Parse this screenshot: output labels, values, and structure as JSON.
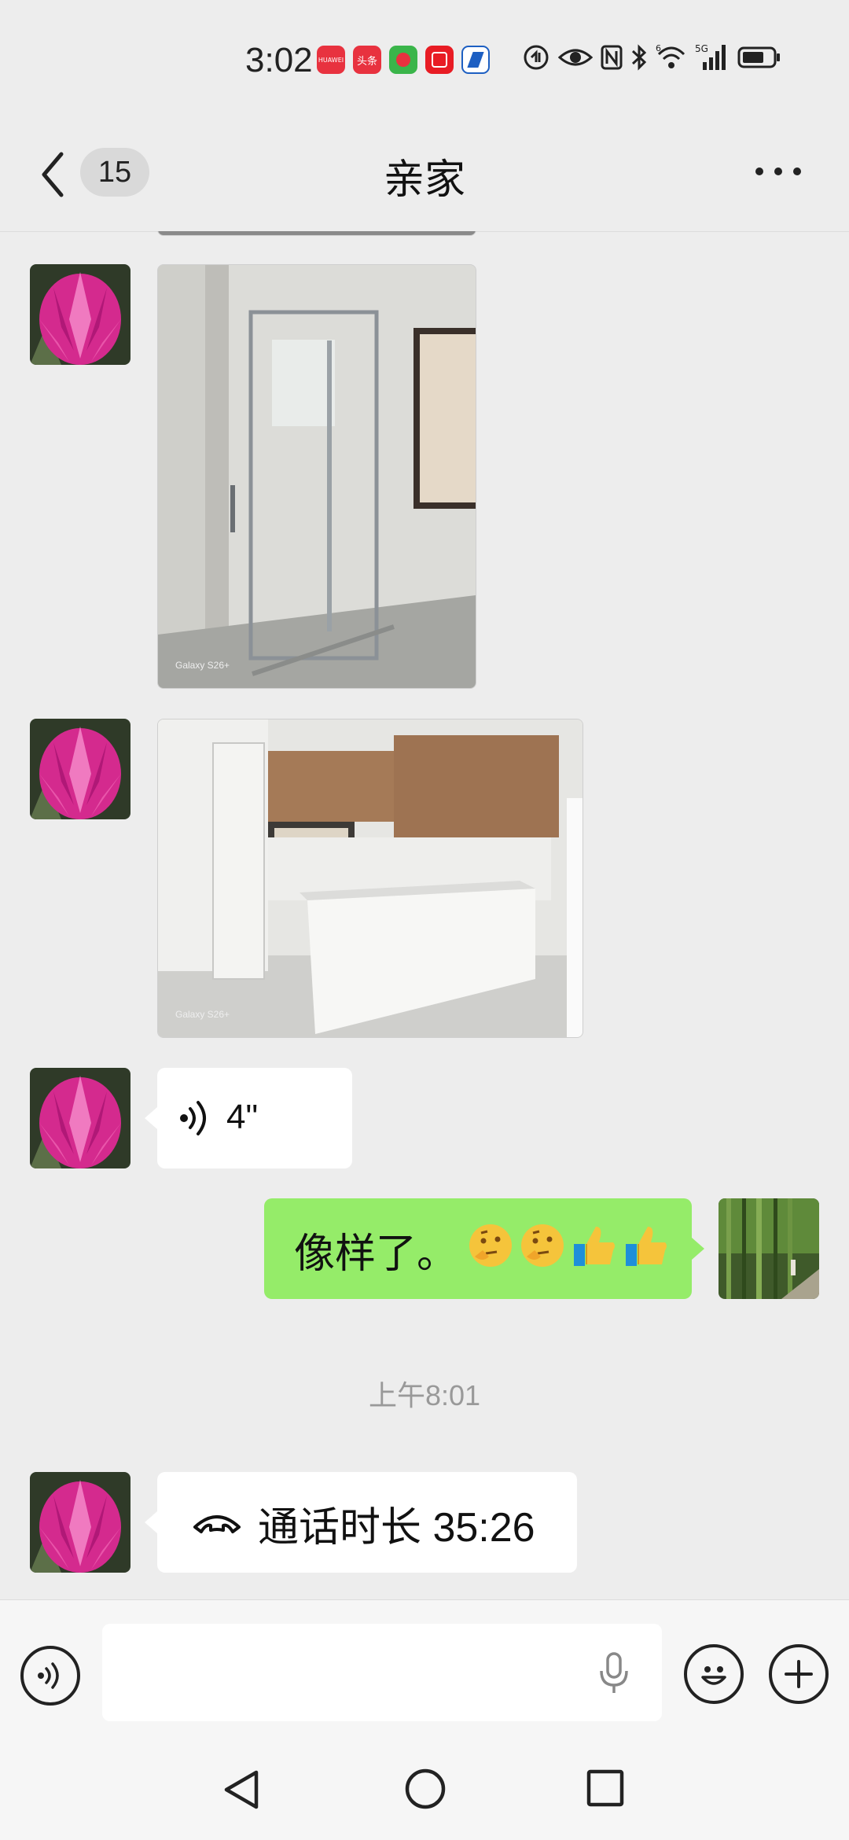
{
  "status_bar": {
    "time": "3:02",
    "apps": [
      {
        "name": "huawei-store-icon",
        "label": "HUAWEI",
        "color": "#e8323f"
      },
      {
        "name": "toutiao-icon",
        "label": "头条",
        "color": "#e8323f"
      },
      {
        "name": "app-green-icon",
        "label": "",
        "color": "#3ab54a"
      },
      {
        "name": "app-red-icon",
        "label": "",
        "color": "#e81c24"
      },
      {
        "name": "app-blue-icon",
        "label": "",
        "color": "#1d5fc2"
      }
    ],
    "network_label": "5G",
    "wifi_label": "6"
  },
  "header": {
    "back_count": "15",
    "title": "亲家"
  },
  "chat": {
    "messages": [
      {
        "type": "image",
        "sender": "contact",
        "watermark": "Galaxy S26+",
        "subject": "shower"
      },
      {
        "type": "image",
        "sender": "contact",
        "watermark": "Galaxy S26+",
        "subject": "kitchen"
      },
      {
        "type": "voice",
        "sender": "contact",
        "duration": "4\""
      },
      {
        "type": "text",
        "sender": "me",
        "text": "像样了。"
      },
      {
        "type": "timestamp",
        "text": "上午8:01"
      },
      {
        "type": "call",
        "sender": "contact",
        "text": "通话时长 35:26"
      }
    ]
  },
  "input_bar": {
    "placeholder": ""
  },
  "colors": {
    "background": "#ededed",
    "outgoing_bubble": "#95ec69",
    "incoming_bubble": "#ffffff"
  }
}
